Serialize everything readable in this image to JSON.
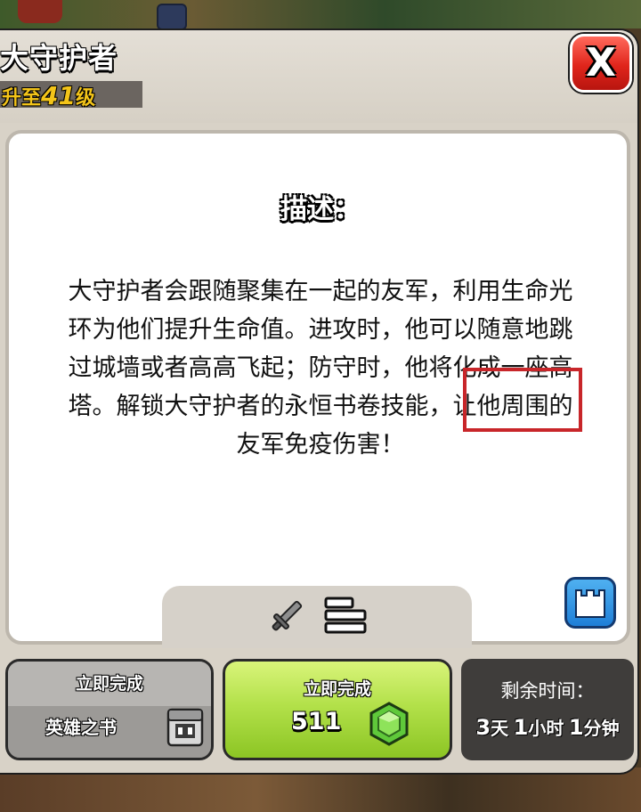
{
  "header": {
    "title": "大守护者",
    "level_prefix": "升至",
    "level_number": "41",
    "level_suffix": "级",
    "close_label": "X"
  },
  "description": {
    "heading": "描述：",
    "text_before": "大守护者会跟随聚集在一起的友军，利用生命光环为他们提升生命值。进攻时，他可以随意地跳过城墙或者高高飞起；防守时，他将化成一座高塔。解锁大守护者的",
    "highlight": "永恒书卷",
    "text_after": "技能，让他周围的友军免疫伤害！"
  },
  "tabs": [
    {
      "icon": "sword-icon"
    },
    {
      "icon": "stats-bars-icon"
    }
  ],
  "info_button": {
    "icon": "tower-icon"
  },
  "actions": {
    "book_button": {
      "label": "立即完成",
      "item": "英雄之书",
      "icon": "hero-book-icon"
    },
    "gem_button": {
      "label": "立即完成",
      "cost": "511",
      "icon": "gem-icon",
      "color": "#b3e14a"
    }
  },
  "remaining": {
    "label": "剩余时间：",
    "days": "3",
    "days_unit": "天",
    "hours": "1",
    "hours_unit": "小时",
    "minutes": "1",
    "minutes_unit": "分钟"
  },
  "colors": {
    "highlight_box": "#c8262a",
    "close_button": "#e0251b",
    "level_text": "#f3c419"
  }
}
